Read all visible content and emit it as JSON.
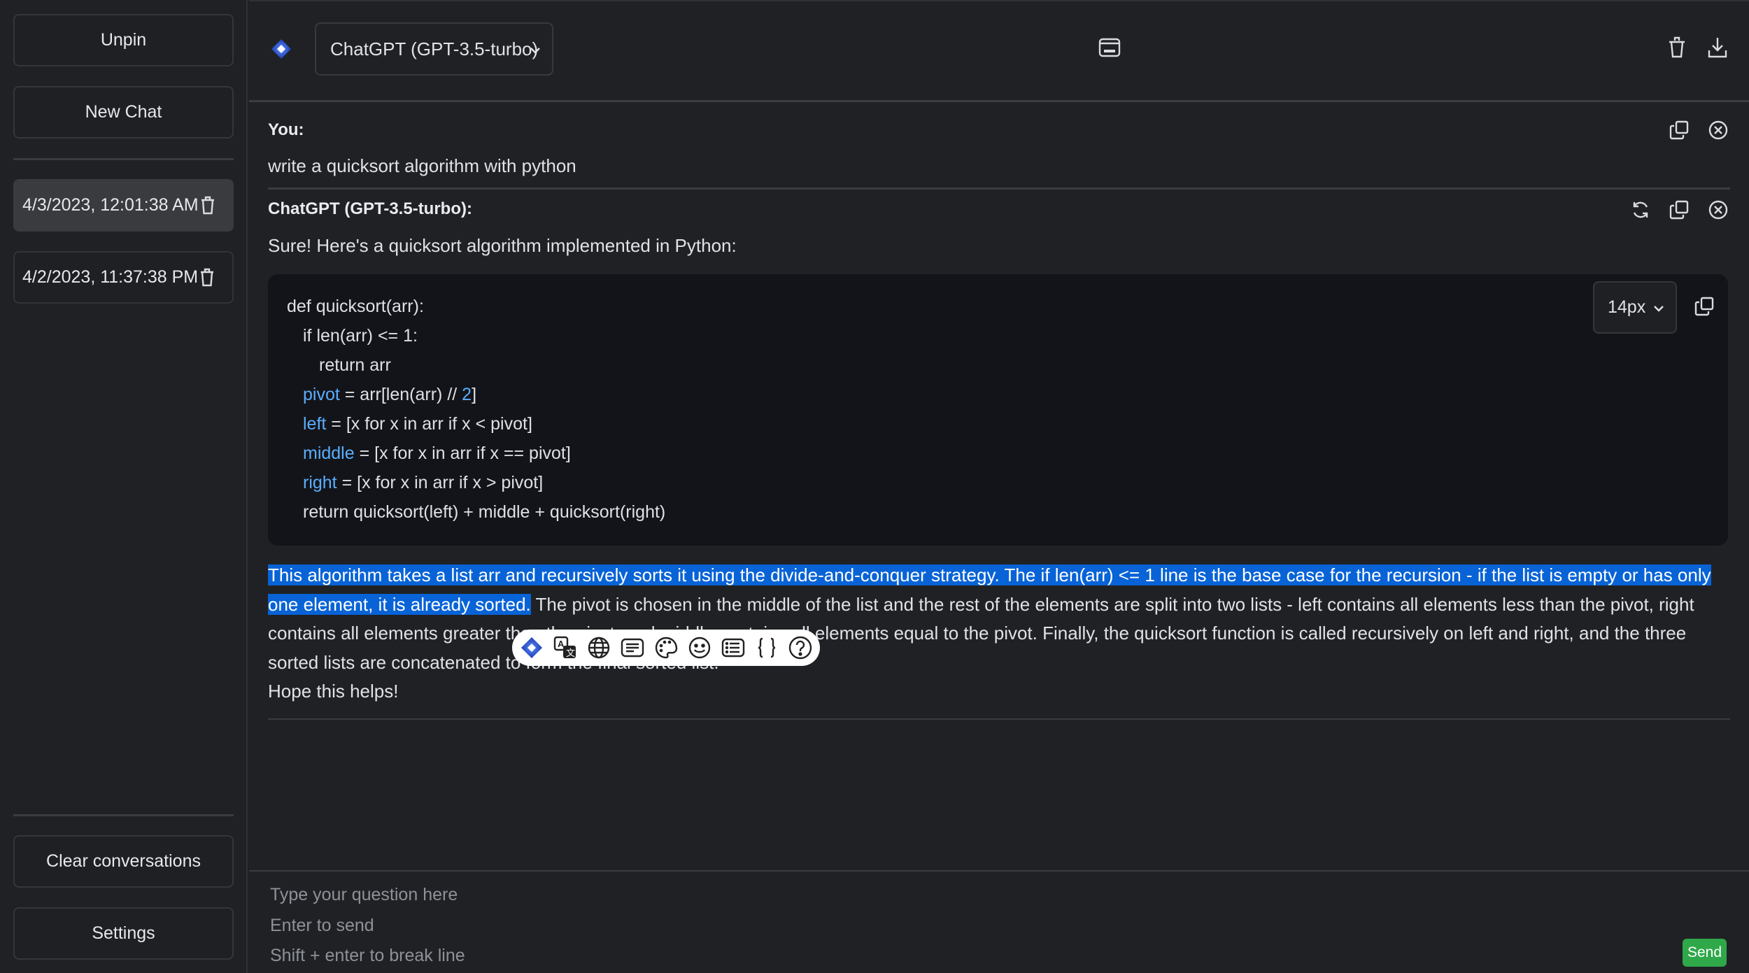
{
  "sidebar": {
    "unpin_label": "Unpin",
    "new_chat_label": "New Chat",
    "conversations": [
      {
        "label": "4/3/2023, 12:01:38 AM",
        "active": true
      },
      {
        "label": "4/2/2023, 11:37:38 PM",
        "active": false
      }
    ],
    "clear_label": "Clear conversations",
    "settings_label": "Settings"
  },
  "header": {
    "model_selected": "ChatGPT (GPT-3.5-turbo)",
    "icons": [
      "panel-icon",
      "trash-icon",
      "download-icon"
    ]
  },
  "messages": [
    {
      "role_label": "You:",
      "text": "write a quicksort algorithm with python",
      "actions": [
        "copy-icon",
        "close-circle-icon"
      ]
    },
    {
      "role_label": "ChatGPT (GPT-3.5-turbo):",
      "intro": "Sure! Here's a quicksort algorithm implemented in Python:",
      "actions": [
        "refresh-icon",
        "copy-icon",
        "close-circle-icon"
      ],
      "code": {
        "font_size_selected": "14px",
        "lines": [
          {
            "indent": 0,
            "parts": [
              {
                "t": "def quicksort(arr):",
                "c": "plain"
              }
            ]
          },
          {
            "indent": 1,
            "parts": [
              {
                "t": "if len(arr) <= 1:",
                "c": "plain"
              }
            ]
          },
          {
            "indent": 2,
            "parts": [
              {
                "t": "return arr",
                "c": "plain"
              }
            ]
          },
          {
            "indent": 1,
            "parts": [
              {
                "t": "pivot",
                "c": "blue"
              },
              {
                "t": " = arr[len(arr) // ",
                "c": "plain"
              },
              {
                "t": "2",
                "c": "blue"
              },
              {
                "t": "]",
                "c": "plain"
              }
            ]
          },
          {
            "indent": 1,
            "parts": [
              {
                "t": "left",
                "c": "blue"
              },
              {
                "t": " = [x for x in arr if x < pivot]",
                "c": "plain"
              }
            ]
          },
          {
            "indent": 1,
            "parts": [
              {
                "t": "middle",
                "c": "blue"
              },
              {
                "t": " = [x for x in arr if x == pivot]",
                "c": "plain"
              }
            ]
          },
          {
            "indent": 1,
            "parts": [
              {
                "t": "right",
                "c": "blue"
              },
              {
                "t": " = [x for x in arr if x > pivot]",
                "c": "plain"
              }
            ]
          },
          {
            "indent": 1,
            "parts": [
              {
                "t": "return quicksort(left) + middle + quicksort(right)",
                "c": "plain"
              }
            ]
          }
        ]
      },
      "explanation_selected": "This algorithm takes a list arr and recursively sorts it using the divide-and-conquer strategy. The if len(arr) <= 1 line is the base case for the recursion - if the list is empty or has only one element, it is already sorted.",
      "explanation_rest": " The pivot is chosen in the middle of the list and the rest of the elements are split into two lists - left contains all elements less than the pivot, right contains all elements greater than the pivot, and middle contains all elements equal to the pivot. Finally, the quicksort function is called recursively on left and right, and the three sorted lists are concatenated to form the final sorted list.",
      "closing": "Hope this helps!"
    }
  ],
  "floating_toolbar": {
    "icons": [
      "app-logo-icon",
      "translate-icon",
      "globe-icon",
      "summary-icon",
      "palette-icon",
      "smiley-icon",
      "list-icon",
      "code-braces-icon",
      "help-icon"
    ]
  },
  "input": {
    "placeholder": "Type your question here\nEnter to send\nShift + enter to break line",
    "value": "",
    "send_label": "Send"
  },
  "colors": {
    "selection": "#0863d6",
    "send": "#2fa84a",
    "code_keyword": "#5aaeff",
    "logo": "#2f5fd6"
  }
}
